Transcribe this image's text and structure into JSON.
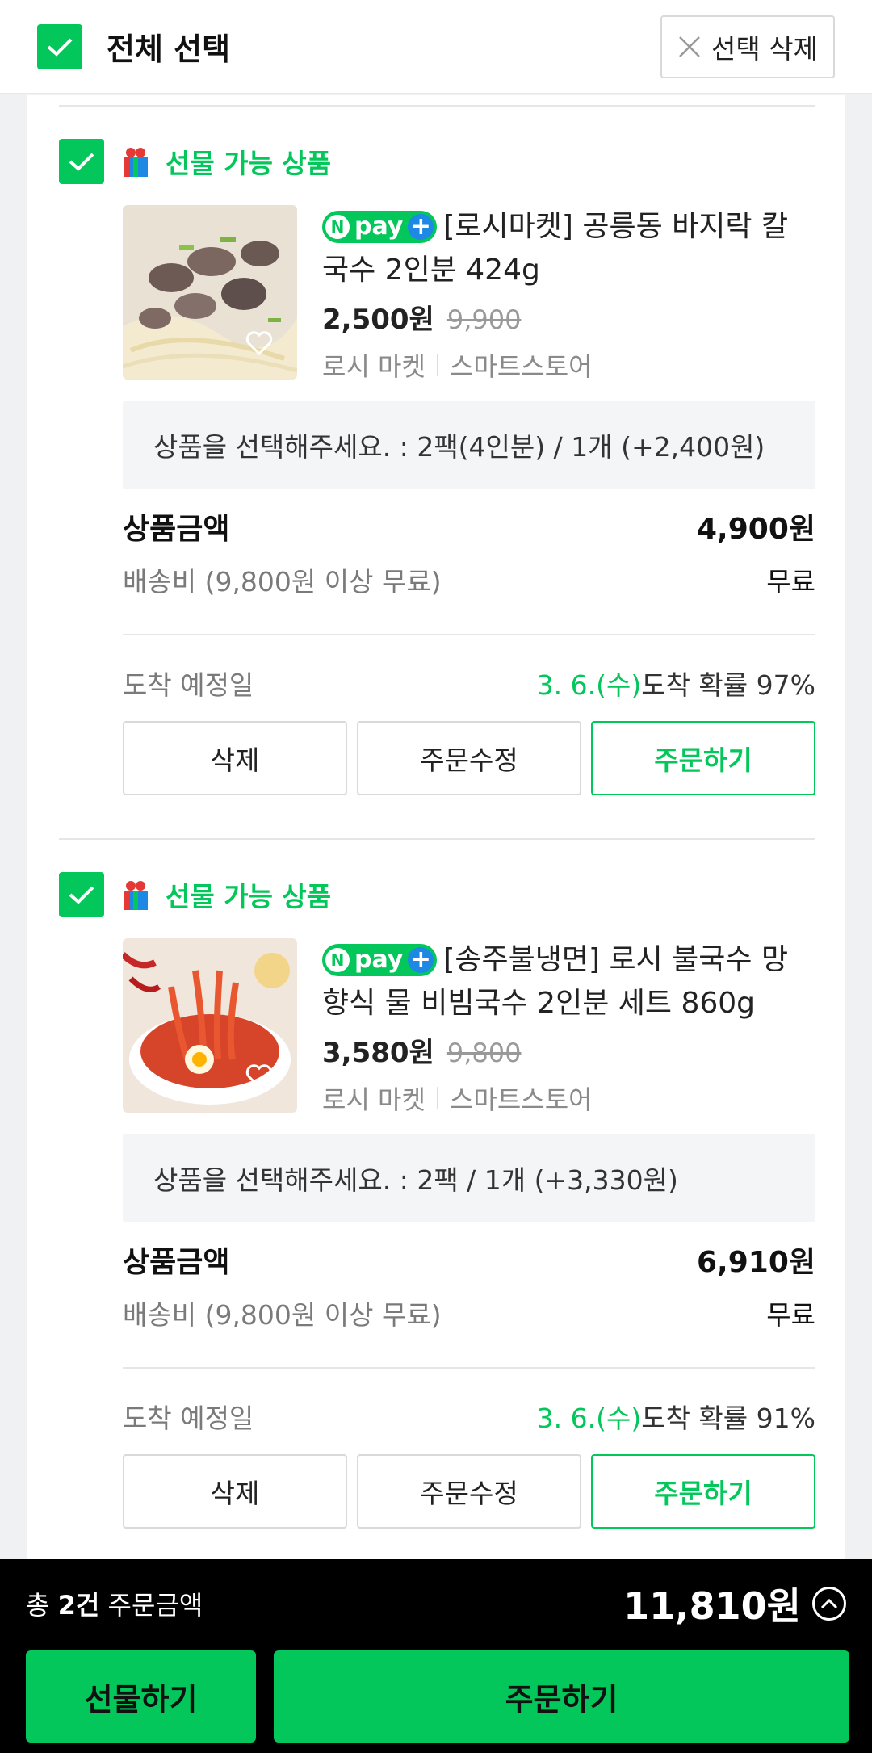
{
  "header": {
    "select_all_label": "전체 선택",
    "delete_selected_label": "선택 삭제"
  },
  "items": [
    {
      "gift_label": "선물 가능 상품",
      "npay_label": "pay",
      "title": "[로시마켓] 공릉동 바지락 칼국수 2인분 424g",
      "price": "2,500원",
      "old_price": "9,900",
      "seller": "로시 마켓",
      "store_type": "스마트스토어",
      "option": "상품을 선택해주세요. : 2팩(4인분) / 1개 (+2,400원)",
      "amount_label": "상품금액",
      "amount": "4,900원",
      "shipping_label": "배송비 (9,800원 이상 무료)",
      "shipping": "무료",
      "arrival_label": "도착 예정일",
      "arrival_date": "3. 6.(수)",
      "arrival_prob": "도착 확률 97%",
      "btn_delete": "삭제",
      "btn_modify": "주문수정",
      "btn_order": "주문하기"
    },
    {
      "gift_label": "선물 가능 상품",
      "npay_label": "pay",
      "title": "[송주불냉면] 로시 불국수 망향식 물 비빔국수 2인분 세트 860g",
      "price": "3,580원",
      "old_price": "9,800",
      "seller": "로시 마켓",
      "store_type": "스마트스토어",
      "option": "상품을 선택해주세요. : 2팩 / 1개 (+3,330원)",
      "amount_label": "상품금액",
      "amount": "6,910원",
      "shipping_label": "배송비 (9,800원 이상 무료)",
      "shipping": "무료",
      "arrival_label": "도착 예정일",
      "arrival_date": "3. 6.(수)",
      "arrival_prob": "도착 확률 91%",
      "btn_delete": "삭제",
      "btn_modify": "주문수정",
      "btn_order": "주문하기"
    }
  ],
  "footer": {
    "count_prefix": "총 ",
    "count": "2건",
    "count_suffix": " 주문금액",
    "total": "11,810원",
    "gift_button": "선물하기",
    "order_button": "주문하기"
  },
  "colors": {
    "accent": "#03c75a",
    "background": "#f0f1f3",
    "bottom_bar": "#000000"
  },
  "icons": [
    "check-icon",
    "close-icon",
    "gift-icon",
    "heart-icon",
    "chevron-up-icon",
    "npay-logo"
  ]
}
